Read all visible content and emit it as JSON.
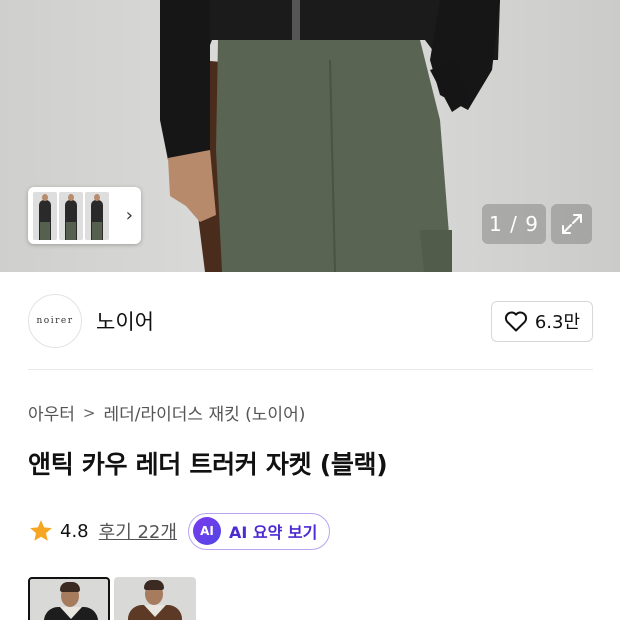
{
  "gallery": {
    "current": "1",
    "total": "9",
    "counter_text": "1 / 9",
    "thumbnail_count": 3
  },
  "brand": {
    "logo_text": "noirer",
    "name": "노이어",
    "like_count": "6.3만"
  },
  "breadcrumb": {
    "items": [
      "아우터",
      "레더/라이더스 재킷 (노이어)"
    ]
  },
  "product": {
    "title": "앤틱 카우 레더 트러커 자켓 (블랙)"
  },
  "rating": {
    "score": "4.8",
    "review_link": "후기 22개",
    "star_color": "#f5a623"
  },
  "ai_summary": {
    "badge": "AI",
    "label": "AI 요약 보기",
    "accent": "#6d3fe6"
  },
  "color_options": [
    {
      "name": "블랙",
      "selected": true
    },
    {
      "name": "브라운",
      "selected": false
    }
  ]
}
